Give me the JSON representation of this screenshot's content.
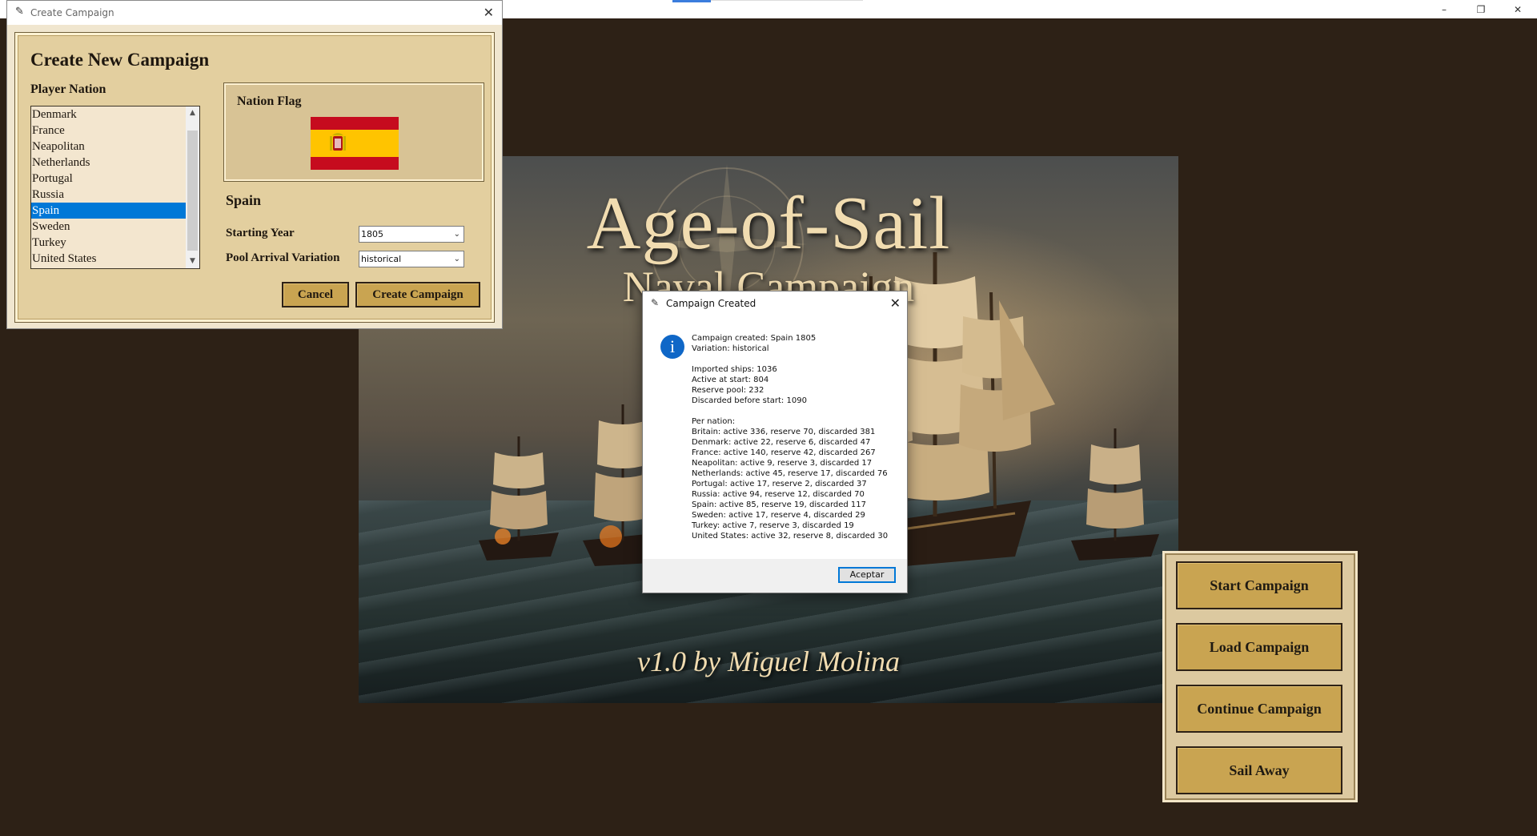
{
  "create_dialog": {
    "window_title": "Create Campaign",
    "heading": "Create New Campaign",
    "nation_label": "Player Nation",
    "nations": [
      "Denmark",
      "France",
      "Neapolitan",
      "Netherlands",
      "Portugal",
      "Russia",
      "Spain",
      "Sweden",
      "Turkey",
      "United States"
    ],
    "selected_nation_index": 6,
    "flag_label": "Nation Flag",
    "selected_nation": "Spain",
    "year_label": "Starting Year",
    "year_value": "1805",
    "variation_label": "Pool Arrival Variation",
    "variation_value": "historical",
    "cancel_label": "Cancel",
    "create_label": "Create Campaign"
  },
  "splash": {
    "title": "Age-of-Sail",
    "subtitle": "Naval Campaign",
    "credit": "v1.0 by Miguel Molina"
  },
  "menu": {
    "start": "Start Campaign",
    "load": "Load Campaign",
    "continue": "Continue Campaign",
    "sail_away": "Sail Away"
  },
  "message_box": {
    "title": "Campaign Created",
    "lines": [
      "Campaign created: Spain 1805",
      "Variation: historical",
      "",
      "Imported ships: 1036",
      "Active at start: 804",
      "Reserve pool: 232",
      "Discarded before start: 1090",
      "",
      "Per nation:",
      "Britain: active 336, reserve 70, discarded 381",
      "Denmark: active 22, reserve 6, discarded 47",
      "France: active 140, reserve 42, discarded 267",
      "Neapolitan: active 9, reserve 3, discarded 17",
      "Netherlands: active 45, reserve 17, discarded 76",
      "Portugal: active 17, reserve 2, discarded 37",
      "Russia: active 94, reserve 12, discarded 70",
      "Spain: active 85, reserve 19, discarded 117",
      "Sweden: active 17, reserve 4, discarded 29",
      "Turkey: active 7, reserve 3, discarded 19",
      "United States: active 32, reserve 8, discarded 30"
    ],
    "accept_label": "Aceptar"
  },
  "window_controls": {
    "minimize": "–",
    "restore": "❐",
    "close": "✕"
  },
  "colors": {
    "background": "#2d2116",
    "button_gold": "#c9a451",
    "panel_tan": "#e3cf9f",
    "selection_blue": "#0078d7",
    "flag_red": "#c60b1e",
    "flag_yellow": "#ffc400"
  },
  "icons": {
    "app": "feather-icon",
    "info": "info-icon"
  }
}
